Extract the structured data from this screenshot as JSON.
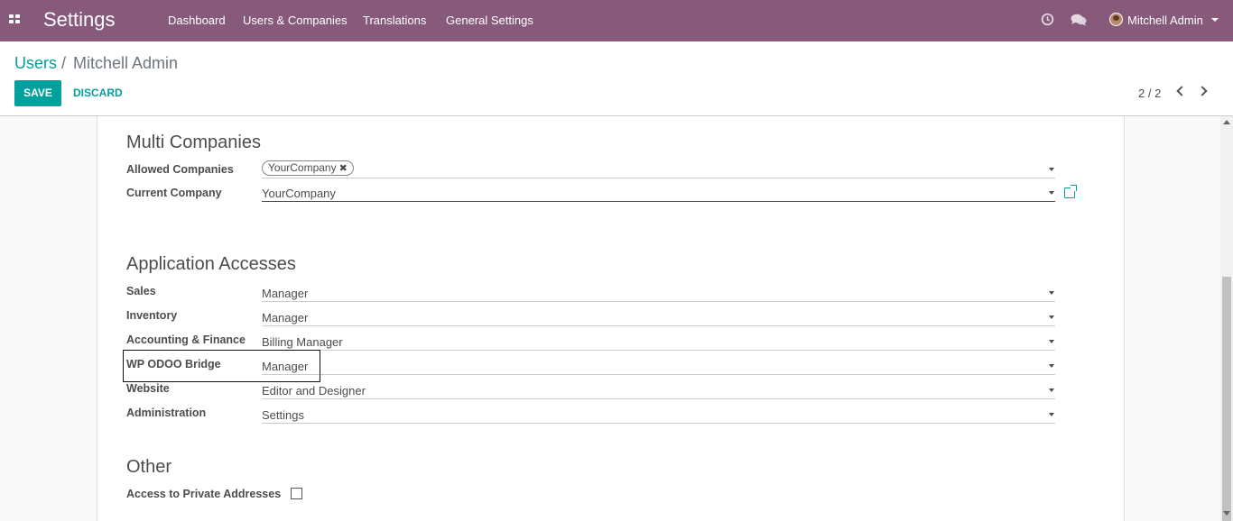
{
  "navbar": {
    "app_title": "Settings",
    "menu": [
      "Dashboard",
      "Users & Companies",
      "Translations",
      "General Settings"
    ],
    "user_name": "Mitchell Admin",
    "icons": [
      "apps-grid-icon",
      "clock-icon",
      "chat-icon",
      "avatar",
      "caret-down-icon"
    ]
  },
  "breadcrumb": {
    "parent": "Users",
    "separator": "/",
    "current": "Mitchell Admin"
  },
  "actions": {
    "save": "SAVE",
    "discard": "DISCARD"
  },
  "pager": {
    "value": "2 / 2"
  },
  "multi_companies": {
    "title": "Multi Companies",
    "allowed_label": "Allowed Companies",
    "allowed_tag": "YourCompany",
    "tag_remove": "✖",
    "current_label": "Current Company",
    "current_value": "YourCompany"
  },
  "app_accesses": {
    "title": "Application Accesses",
    "rows": [
      {
        "label": "Sales",
        "value": "Manager"
      },
      {
        "label": "Inventory",
        "value": "Manager"
      },
      {
        "label": "Accounting & Finance",
        "value": "Billing Manager"
      },
      {
        "label": "WP ODOO Bridge",
        "value": "Manager"
      },
      {
        "label": "Website",
        "value": "Editor and Designer"
      },
      {
        "label": "Administration",
        "value": "Settings"
      }
    ]
  },
  "other": {
    "title": "Other",
    "private_label": "Access to Private Addresses",
    "private_checked": false
  },
  "colors": {
    "navbar": "#875a7b",
    "accent": "#00A09D"
  }
}
